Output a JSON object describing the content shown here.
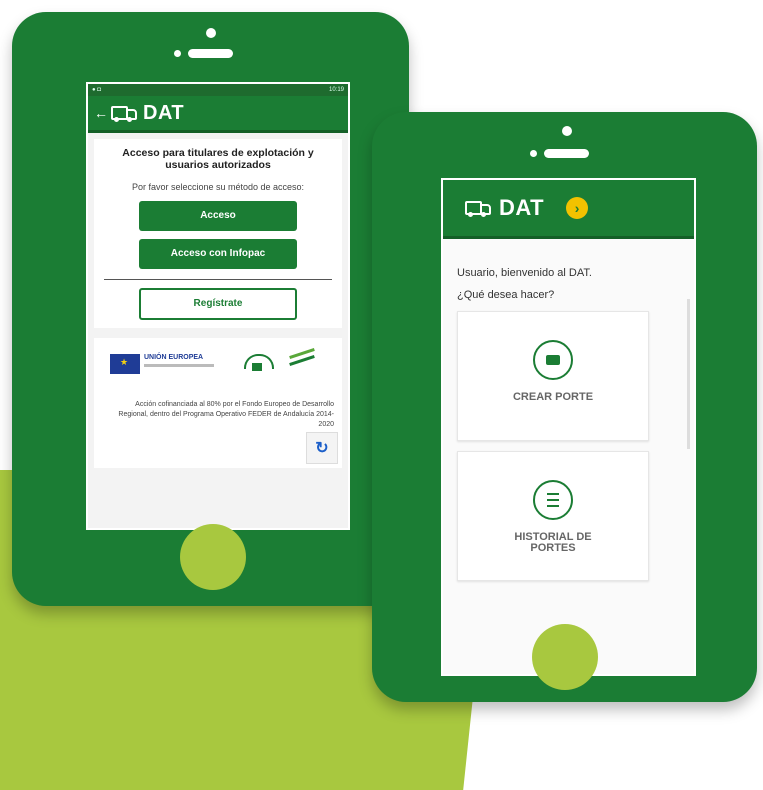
{
  "colors": {
    "green": "#1b7d34",
    "lime": "#a8c83f",
    "accent_yellow": "#f2c200"
  },
  "phone1": {
    "status_time": "10:19",
    "app_title": "DAT",
    "back_icon": "arrow-left-icon",
    "heading": "Acceso para titulares de explotación y usuarios autorizados",
    "prompt": "Por favor seleccione su método de acceso:",
    "buttons": {
      "access": "Acceso",
      "infopac": "Acceso con Infopac",
      "register": "Regístrate"
    },
    "footer": {
      "eu_label": "UNIÓN EUROPEA",
      "funding_text": "Acción cofinanciada al 80% por el Fondo Europeo de Desarrollo Regional, dentro del Programa Operativo FEDER de Andalucía 2014-2020"
    }
  },
  "phone2": {
    "app_title": "DAT",
    "welcome": "Usuario, bienvenido al DAT.",
    "question": "¿Qué desea hacer?",
    "actions": [
      {
        "label": "CREAR PORTE",
        "icon": "truck-icon"
      },
      {
        "label": "HISTORIAL DE PORTES",
        "icon": "list-icon"
      }
    ]
  }
}
